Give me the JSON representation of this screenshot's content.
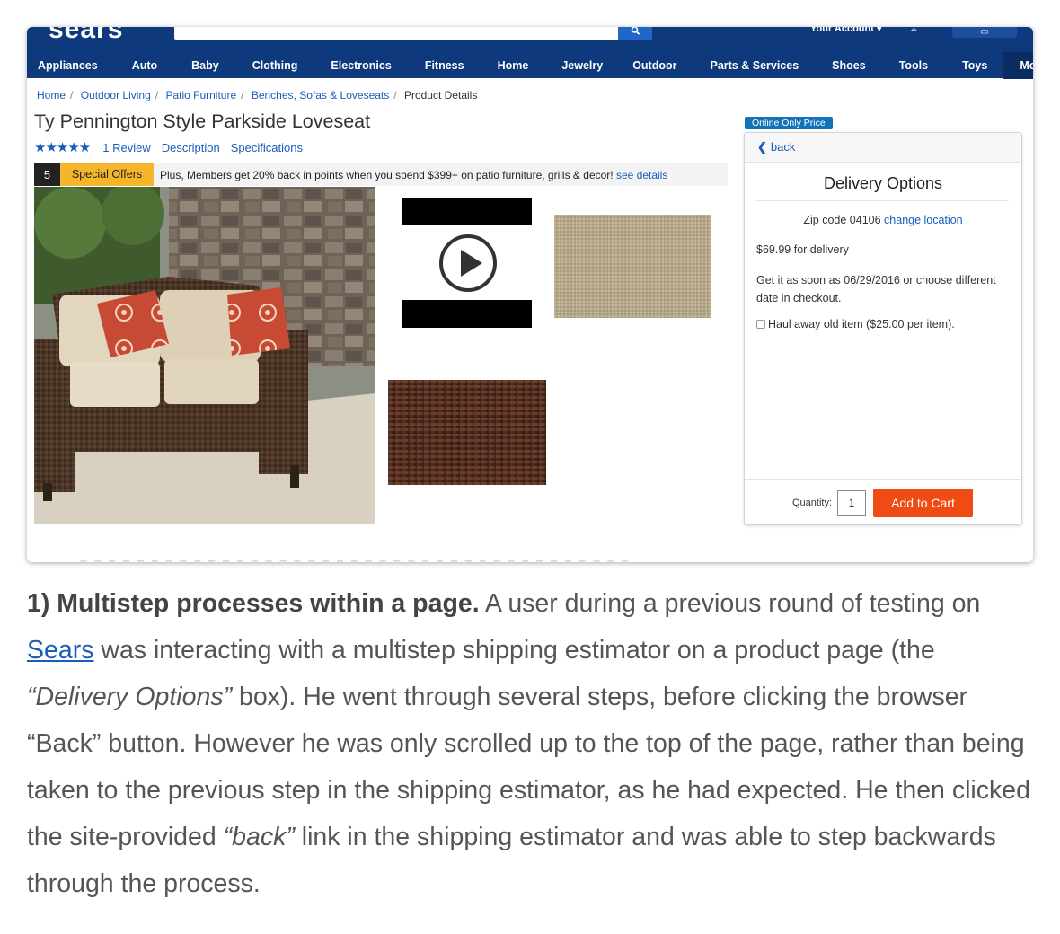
{
  "screenshot": {
    "header": {
      "logo_fragment": "sears",
      "account_label": "Your Account ▾",
      "search_icon": "search-icon",
      "location_icon": "pin-icon",
      "cart_icon": "cart-icon"
    },
    "nav": {
      "items": [
        "Appliances",
        "Auto",
        "Baby",
        "Clothing",
        "Electronics",
        "Fitness",
        "Home",
        "Jewelry",
        "Outdoor",
        "Parts & Services",
        "Shoes",
        "Tools",
        "Toys"
      ],
      "more_label": "More..."
    },
    "breadcrumbs": [
      "Home",
      "Outdoor Living",
      "Patio Furniture",
      "Benches, Sofas & Loveseats",
      "Product Details"
    ],
    "product": {
      "title": "Ty Pennington Style Parkside Loveseat",
      "stars": "★★★★★",
      "rating_value": 5,
      "reviews_link": "1 Review",
      "description_link": "Description",
      "specifications_link": "Specifications"
    },
    "offers": {
      "count": "5",
      "label": "Special Offers",
      "message": "Plus, Members get 20% back in points when you spend $399+ on patio furniture, grills & decor!",
      "link": "see details"
    },
    "media": {
      "main_image": "loveseat-image",
      "video_thumb": "play-icon",
      "swatch_1": "tan-fabric-swatch",
      "swatch_2": "brown-wicker-swatch"
    },
    "delivery": {
      "badge": "Online Only Price",
      "back_label": "back",
      "title": "Delivery Options",
      "zip_prefix": "Zip code 04106",
      "zip_link": "change location",
      "price_amount": "$69.99",
      "price_suffix": "for delivery",
      "eta_prefix": "Get it as soon as",
      "eta_date": "06/29/2016",
      "eta_suffix": "or choose different date in checkout.",
      "haul_label": "Haul away old item ($25.00 per item).",
      "quantity_label": "Quantity:",
      "quantity_value": "1",
      "add_to_cart": "Add to Cart"
    },
    "colors": {
      "header_blue": "#0e3a7d",
      "link_blue": "#1a5db8",
      "offer_yellow": "#f5b62b",
      "cart_orange": "#ef4b12",
      "badge_blue": "#1273b9"
    }
  },
  "article": {
    "lead_bold": "1) Multistep processes within a page.",
    "t1": " A user during a previous round of testing on ",
    "link_sears": "Sears",
    "t2": " was interacting with a multistep shipping estimator on a product page (the ",
    "italic_delivery": "“Delivery Options”",
    "t3": " box). He went through several steps, before clicking the browser “Back” button. However he was only scrolled up to the top of the page, rather than being taken to the previous step in the shipping estimator, as he had expected. He then clicked the site-provided ",
    "italic_back": "“back”",
    "t4": " link in the shipping estimator and was able to step backwards through the process."
  }
}
